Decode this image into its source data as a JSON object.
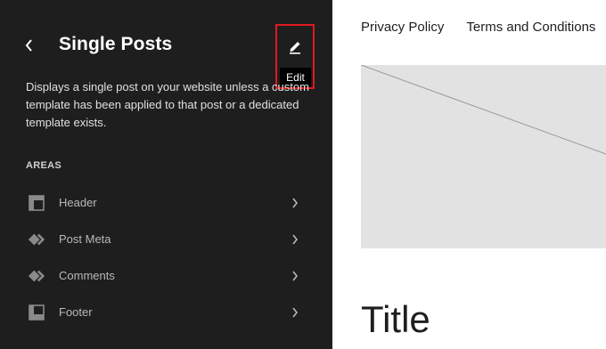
{
  "sidebar": {
    "title": "Single Posts",
    "description": "Displays a single post on your website unless a custom template has been applied to that post or a dedicated template exists.",
    "areas_heading": "AREAS",
    "edit_tooltip": "Edit",
    "areas": [
      {
        "label": "Header",
        "icon": "header-layout-icon"
      },
      {
        "label": "Post Meta",
        "icon": "pattern-diamond-icon"
      },
      {
        "label": "Comments",
        "icon": "pattern-diamond-icon"
      },
      {
        "label": "Footer",
        "icon": "footer-layout-icon"
      }
    ],
    "highlight_color": "#e0191f",
    "background_color": "#1e1e1e"
  },
  "preview": {
    "nav_links": [
      "Privacy Policy",
      "Terms and Conditions"
    ],
    "post_title": "Title",
    "image_placeholder_color": "#e2e2e2"
  }
}
